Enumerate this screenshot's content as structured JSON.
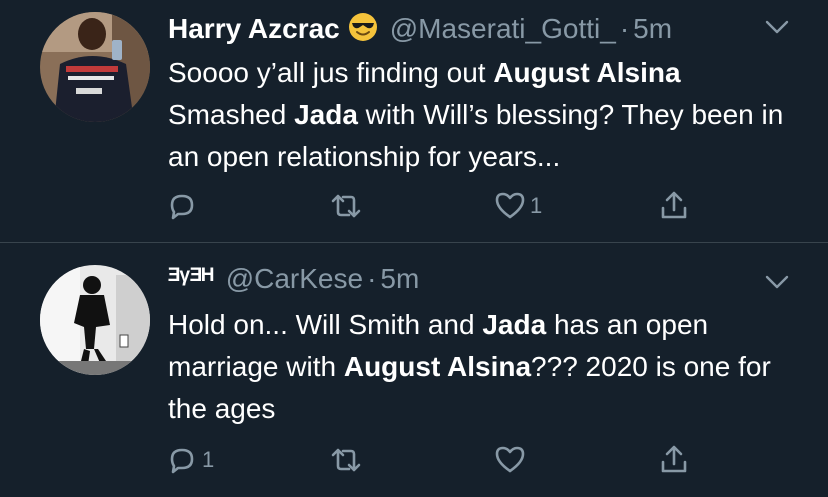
{
  "tweets": [
    {
      "name": "Harry Azcrac",
      "name_emoji": "sunglasses-emoji",
      "handle": "@Maserati_Gotti_",
      "separator": "·",
      "time": "5m",
      "text_parts": [
        {
          "text": "Soooo y’all jus finding out ",
          "bold": false
        },
        {
          "text": "August Alsina",
          "bold": true
        },
        {
          "text": " Smashed ",
          "bold": false
        },
        {
          "text": "Jada",
          "bold": true
        },
        {
          "text": " with Will’s blessing? They been in an open relationship for years...",
          "bold": false
        }
      ],
      "reply_count": "",
      "retweet_count": "",
      "like_count": "1"
    },
    {
      "name": "ᴲᵞᴲᴴ",
      "handle": "@CarKese",
      "separator": "·",
      "time": "5m",
      "text_parts": [
        {
          "text": "Hold on... Will Smith and ",
          "bold": false
        },
        {
          "text": "Jada",
          "bold": true
        },
        {
          "text": " has an open marriage with ",
          "bold": false
        },
        {
          "text": "August Alsina",
          "bold": true
        },
        {
          "text": "??? 2020 is one for the ages",
          "bold": false
        }
      ],
      "reply_count": "1",
      "retweet_count": "",
      "like_count": ""
    }
  ],
  "colors": {
    "background": "#15202b",
    "secondary_text": "#8899a6",
    "divider": "#38444d"
  }
}
